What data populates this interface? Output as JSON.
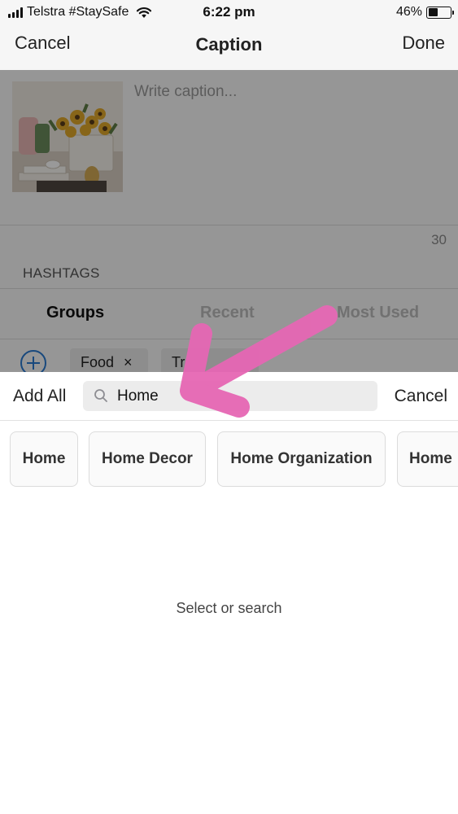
{
  "status_bar": {
    "carrier": "Telstra #StaySafe",
    "time": "6:22 pm",
    "battery_percent": "46%",
    "battery_level": 0.46,
    "icons": [
      "signal-icon",
      "wifi-icon",
      "battery-icon"
    ]
  },
  "nav": {
    "cancel_label": "Cancel",
    "title": "Caption",
    "done_label": "Done"
  },
  "caption": {
    "placeholder": "Write caption...",
    "char_count": "30",
    "hashtags_label": "HASHTAGS"
  },
  "tabs": [
    {
      "label": "Groups",
      "active": true
    },
    {
      "label": "Recent",
      "active": false
    },
    {
      "label": "Most Used",
      "active": false
    }
  ],
  "tag_chips": [
    {
      "label": "Food",
      "remove": "×"
    },
    {
      "label": "Tr"
    }
  ],
  "search": {
    "add_all_label": "Add All",
    "value": "Home",
    "cancel_label": "Cancel"
  },
  "results": [
    {
      "label": "Home"
    },
    {
      "label": "Home Decor"
    },
    {
      "label": "Home Organization"
    },
    {
      "label": "Home"
    }
  ],
  "empty_message": "Select or search",
  "colors": {
    "accent_blue": "#2b7bd1",
    "annotation_pink": "#e667b4",
    "inactive_tab": "#bcbcbc"
  }
}
